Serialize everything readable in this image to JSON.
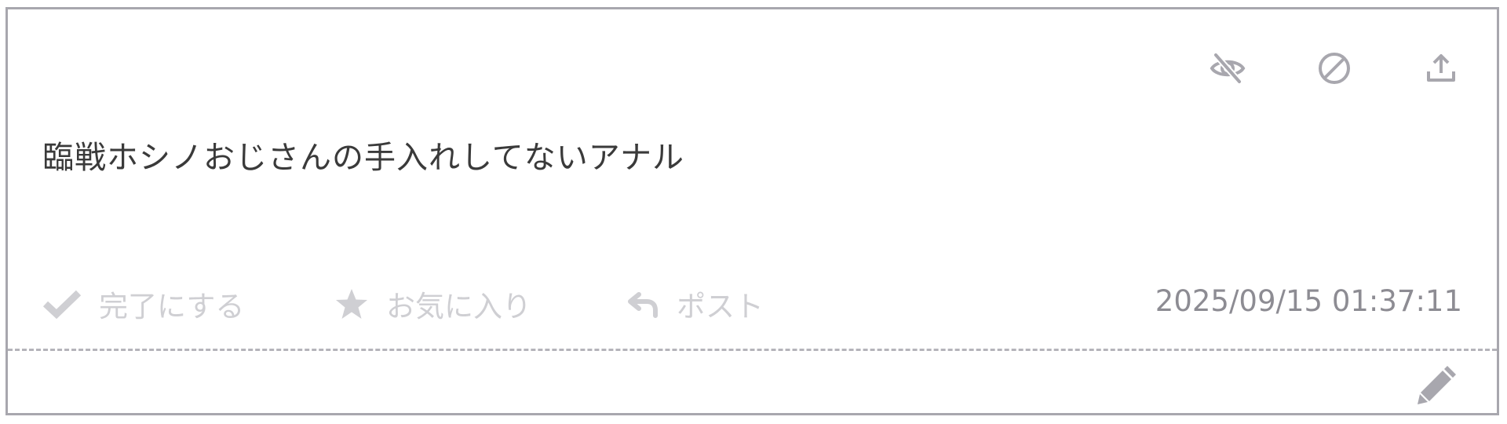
{
  "post": {
    "message": "臨戦ホシノおじさんの手入れしてないアナル",
    "timestamp": "2025/09/15 01:37:11"
  },
  "top_icons": [
    "eye-slash-icon",
    "ban-icon",
    "upload-icon"
  ],
  "actions": {
    "complete_label": "完了にする",
    "favorite_label": "お気に入り",
    "post_label": "ポスト"
  },
  "colors": {
    "icon_gray": "#a8a7ae",
    "action_disabled": "#cfcfd3",
    "timestamp": "#8d8c93",
    "text": "#3a3a3a",
    "border": "#a8a7ae"
  }
}
